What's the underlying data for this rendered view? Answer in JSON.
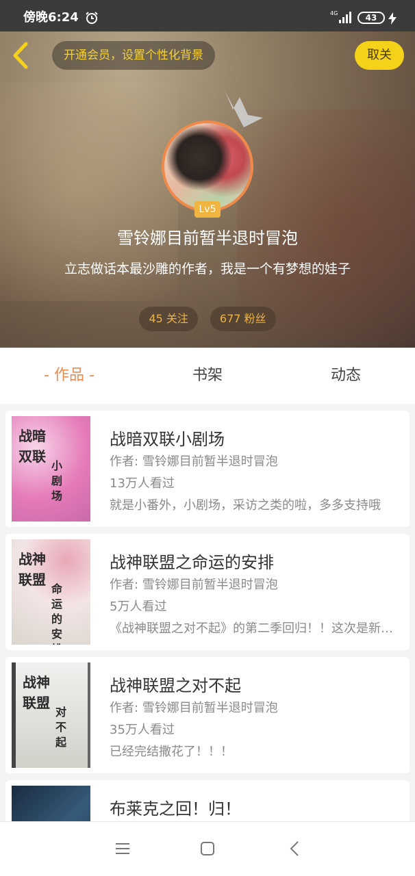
{
  "status_bar": {
    "time": "傍晚6:24",
    "network": "4G",
    "battery": "43"
  },
  "header": {
    "vip_banner": "开通会员，设置个性化背景",
    "unfollow_label": "取关",
    "level": "Lv5",
    "username": "雪铃娜目前暂半退时冒泡",
    "bio": "立志做话本最沙雕的作者，我是一个有梦想的娃子",
    "following": "45 关注",
    "followers": "677 粉丝"
  },
  "tabs": [
    {
      "label": "作品",
      "active": true
    },
    {
      "label": "书架",
      "active": false
    },
    {
      "label": "动态",
      "active": false
    }
  ],
  "works": [
    {
      "title": "战暗双联小剧场",
      "author": "作者: 雪铃娜目前暂半退时冒泡",
      "views": "13万人看过",
      "desc": "就是小番外，小剧场，采访之类的啦，多多支持哦",
      "cover_title": "战暗双联",
      "cover_sub": "小剧场"
    },
    {
      "title": "战神联盟之命运的安排",
      "author": "作者: 雪铃娜目前暂半退时冒泡",
      "views": "5万人看过",
      "desc": "《战神联盟之对不起》的第二季回归！！这次是新的故事",
      "cover_title": "战神联盟",
      "cover_sub": "命运的安排"
    },
    {
      "title": "战神联盟之对不起",
      "author": "作者: 雪铃娜目前暂半退时冒泡",
      "views": "35万人看过",
      "desc": "已经完结撒花了！！！",
      "cover_title": "战神联盟",
      "cover_sub": "对不起"
    },
    {
      "title": "布莱克之回！归！",
      "author": "",
      "views": "",
      "desc": "",
      "cover_title": "",
      "cover_sub": ""
    }
  ],
  "colors": {
    "accent": "#ef8a4e",
    "vip_text": "#f5d03a",
    "unfollow_bg": "#f5d21a",
    "stat_text": "#f0b441"
  },
  "icons": {
    "back": "chevron-left-icon",
    "alarm": "alarm-clock-icon",
    "crown": "crown-icon",
    "menu": "menu-icon",
    "home": "square-home-icon",
    "nav_back": "triangle-back-icon"
  }
}
